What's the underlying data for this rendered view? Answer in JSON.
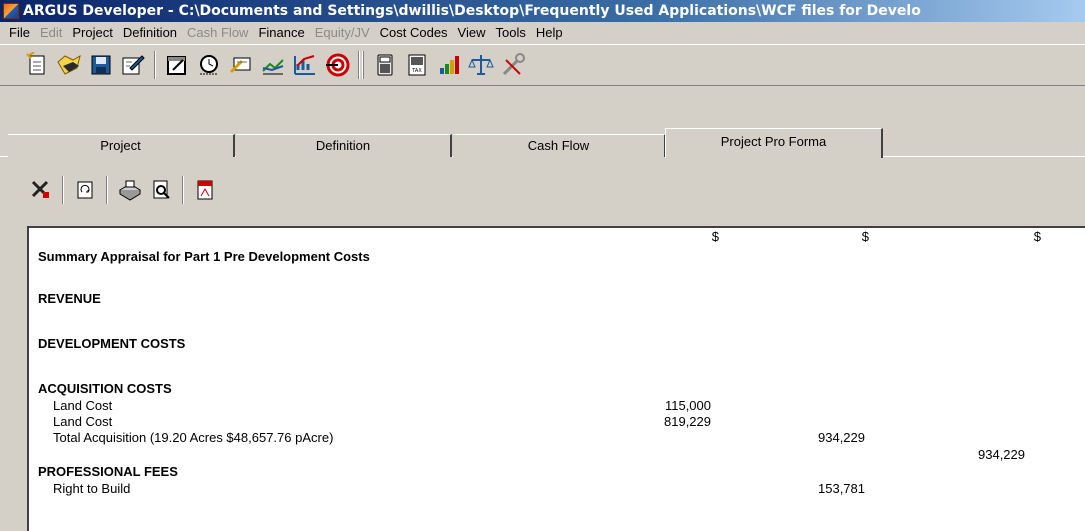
{
  "window": {
    "title": "ARGUS Developer - C:\\Documents and Settings\\dwillis\\Desktop\\Frequently Used Applications\\WCF files for Develo"
  },
  "menu": [
    {
      "label": "File",
      "enabled": true
    },
    {
      "label": "Edit",
      "enabled": false
    },
    {
      "label": "Project",
      "enabled": true
    },
    {
      "label": "Definition",
      "enabled": true
    },
    {
      "label": "Cash Flow",
      "enabled": false
    },
    {
      "label": "Finance",
      "enabled": true
    },
    {
      "label": "Equity/JV",
      "enabled": false
    },
    {
      "label": "Cost Codes",
      "enabled": true
    },
    {
      "label": "View",
      "enabled": true
    },
    {
      "label": "Tools",
      "enabled": true
    },
    {
      "label": "Help",
      "enabled": true
    }
  ],
  "toolbar_icons": [
    "new-document-icon",
    "open-folder-icon",
    "save-icon",
    "edit-icon",
    "notepad-icon",
    "timer-icon",
    "inputs-icon",
    "chart-icon",
    "growth-chart-icon",
    "target-icon",
    "calculator-icon",
    "tax-calculator-icon",
    "bar-chart-icon",
    "scales-icon",
    "tools-icon"
  ],
  "tabs": [
    {
      "label": "Project",
      "active": false
    },
    {
      "label": "Definition",
      "active": false
    },
    {
      "label": "Cash Flow",
      "active": false
    },
    {
      "label": "Project Pro Forma",
      "active": true
    }
  ],
  "report_toolbar_icons": [
    "filter-icon",
    "refresh-icon",
    "print-icon",
    "print-preview-icon",
    "pdf-icon"
  ],
  "report": {
    "currency_headers": [
      "$",
      "$",
      "$"
    ],
    "title": "Summary Appraisal for Part 1 Pre Development Costs",
    "sections": {
      "revenue": "REVENUE",
      "development_costs": "DEVELOPMENT COSTS",
      "acquisition_costs": "ACQUISITION COSTS",
      "professional_fees": "PROFESSIONAL FEES"
    },
    "rows": {
      "land_cost_1": {
        "label": "Land Cost",
        "value": "115,000"
      },
      "land_cost_2": {
        "label": "Land Cost",
        "value": "819,229"
      },
      "total_acquisition": {
        "label": "Total Acquisition (19.20 Acres  $48,657.76 pAcre)",
        "value": "934,229"
      },
      "acquisition_subtotal": {
        "value": "934,229"
      },
      "right_to_build": {
        "label": "Right to Build",
        "value": "153,781"
      }
    }
  }
}
